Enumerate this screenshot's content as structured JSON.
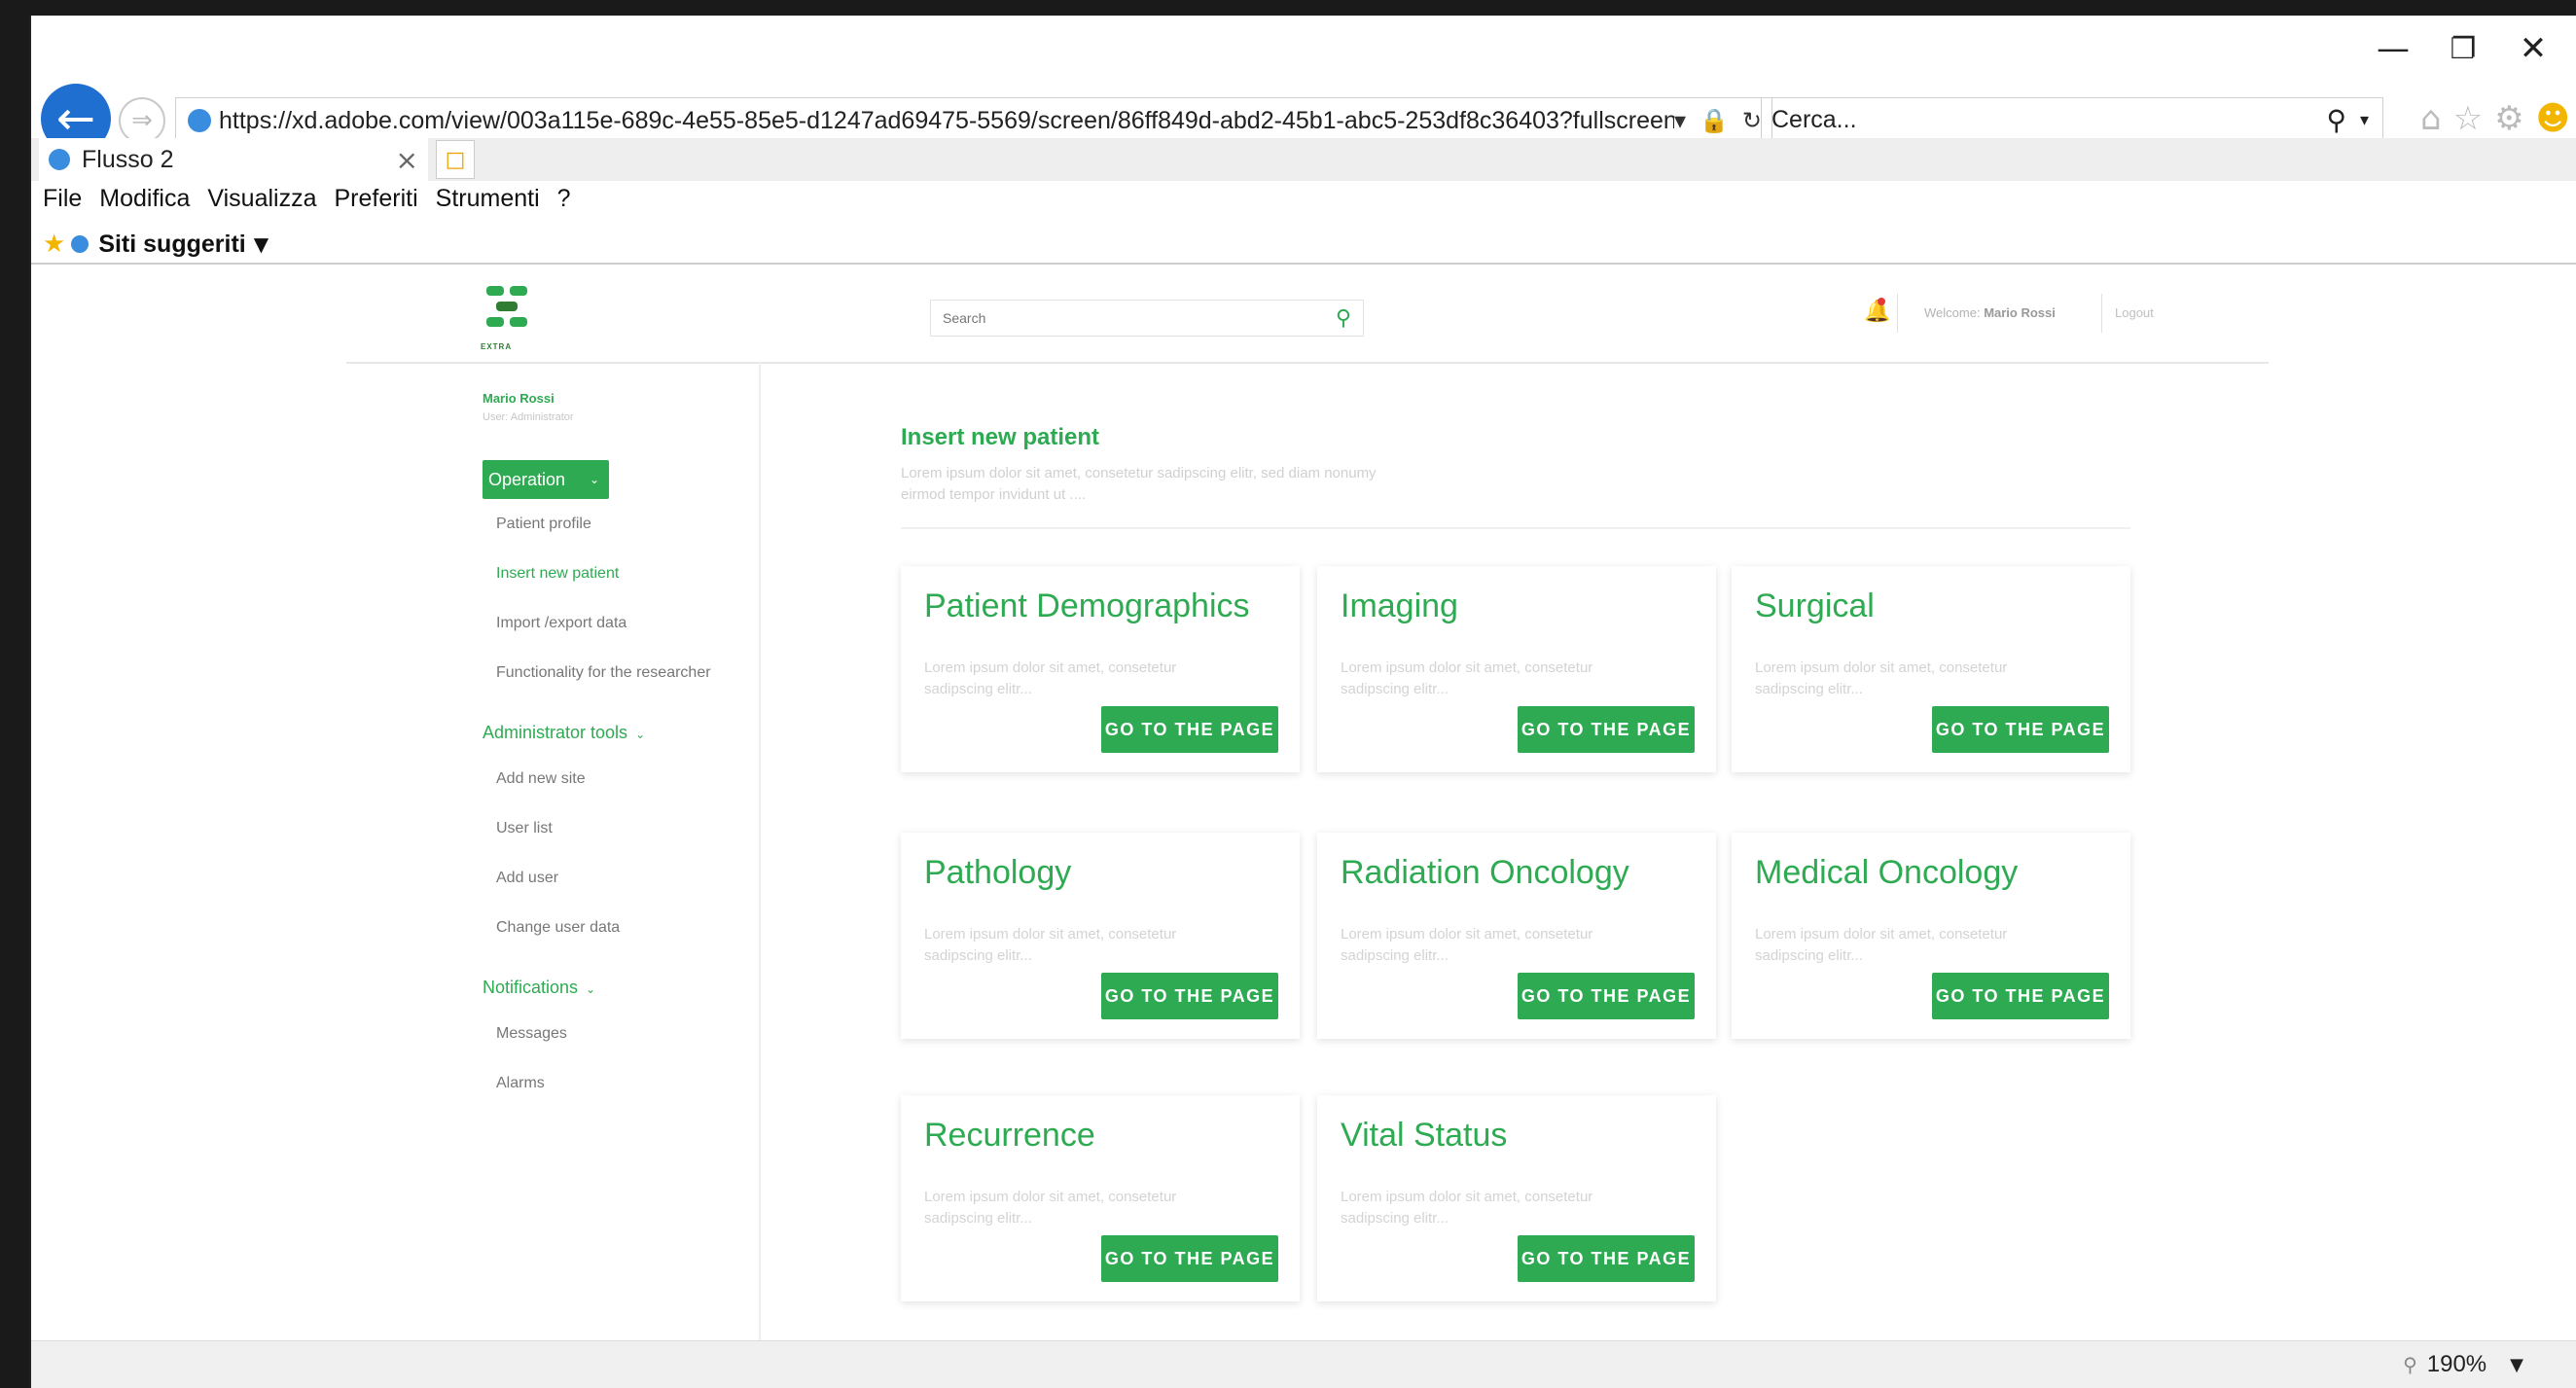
{
  "browser": {
    "url": "https://xd.adobe.com/view/003a115e-689c-4e55-85e5-d1247ad69475-5569/screen/86ff849d-abd2-45b1-abc5-253df8c36403?fullscreen",
    "search_placeholder": "Cerca...",
    "tab_title": "Flusso 2",
    "menu": [
      "File",
      "Modifica",
      "Visualizza",
      "Preferiti",
      "Strumenti",
      "?"
    ],
    "favorites_label": "Siti suggeriti",
    "zoom": "190%"
  },
  "app": {
    "search_placeholder": "Search",
    "welcome_prefix": "Welcome:",
    "welcome_user": "Mario Rossi",
    "logout": "Logout",
    "logo_text": "EXTRA",
    "user": {
      "name": "Mario Rossi",
      "role": "User: Administrator"
    },
    "sidebar": {
      "operation_label": "Operation",
      "operation_items": [
        "Patient profile",
        "Insert new patient",
        "Import /export data",
        "Functionality for the researcher"
      ],
      "admin_label": "Administrator tools",
      "admin_items": [
        "Add new site",
        "User list",
        "Add user",
        "Change user data"
      ],
      "notifications_label": "Notifications",
      "notification_items": [
        "Messages",
        "Alarms"
      ]
    },
    "main": {
      "title": "Insert new patient",
      "description": "Lorem ipsum dolor sit amet, consetetur sadipscing elitr, sed diam nonumy eirmod tempor invidunt ut ....",
      "card_description": "Lorem ipsum dolor sit amet, consetetur sadipscing elitr...",
      "button_label": "GO TO THE PAGE",
      "cards": [
        "Patient Demographics",
        "Imaging",
        "Surgical",
        "Pathology",
        "Radiation Oncology",
        "Medical Oncology",
        "Recurrence",
        "Vital Status"
      ]
    }
  },
  "colors": {
    "accent": "#2eab52",
    "browser_blue": "#1e6fcf"
  }
}
